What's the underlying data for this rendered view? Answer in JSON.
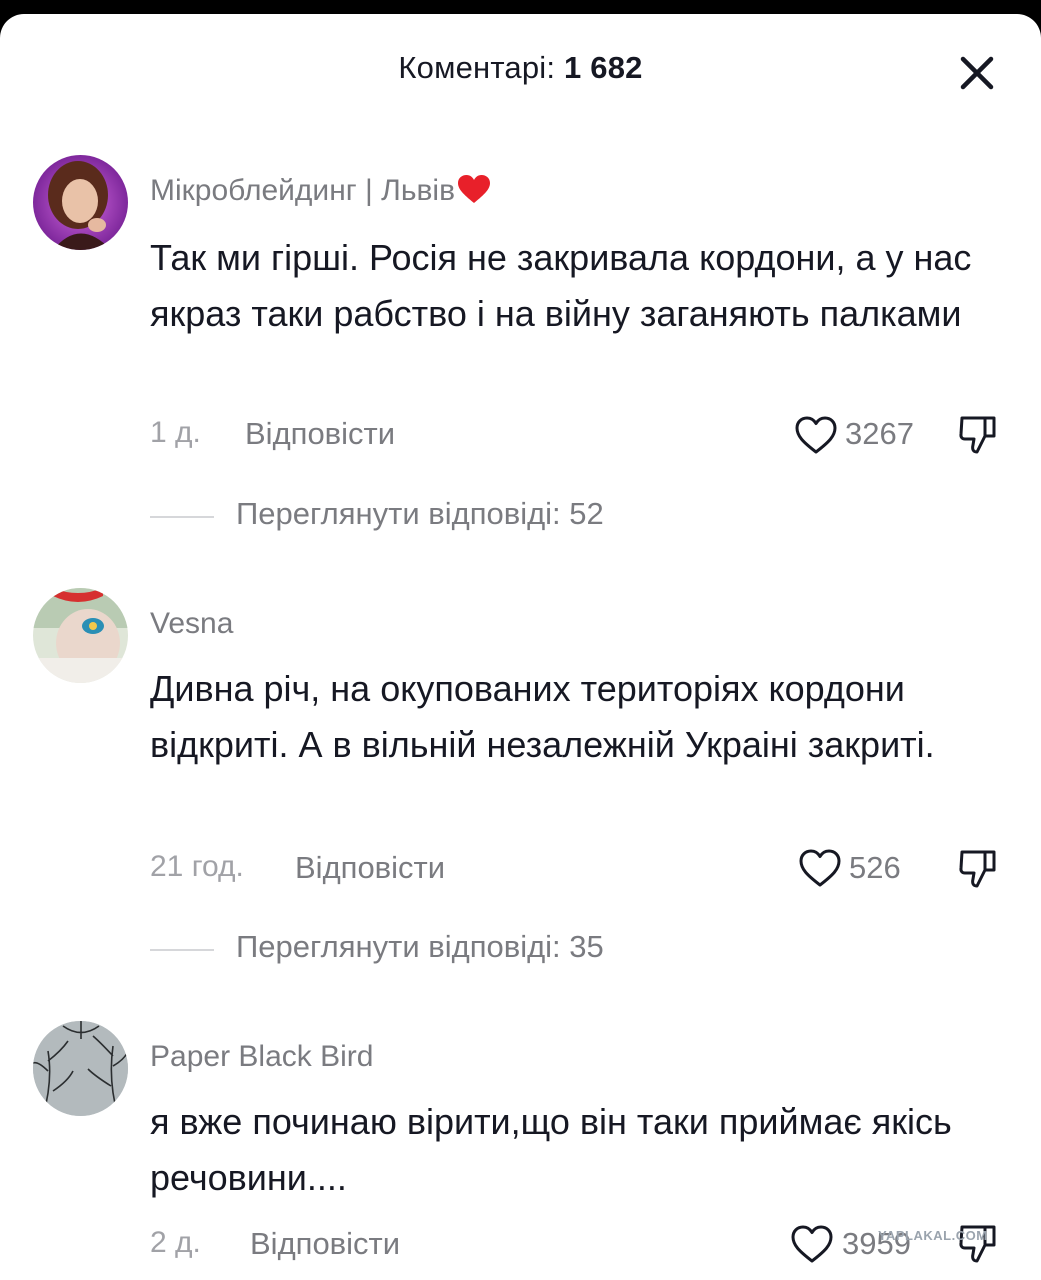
{
  "header": {
    "title_prefix": "Коментарі: ",
    "count": "1 682"
  },
  "comments": [
    {
      "username": "Мікроблейдинг | Львів",
      "username_emoji": "red-heart",
      "text": "Так ми гірші. Росія не закривала кордони, а у нас якраз таки рабство і на війну заганяють палками",
      "time": "1 д.",
      "reply_label": "Відповісти",
      "likes": "3267",
      "replies_label": "Переглянути відповіді: 52"
    },
    {
      "username": "Vesna",
      "text": "Дивна річ, на окупованих територіях кордони відкриті. А в вільній незалежній Украіні закриті.",
      "time": "21 год.",
      "reply_label": "Відповісти",
      "likes": "526",
      "replies_label": "Переглянути відповіді: 35"
    },
    {
      "username": "Paper Black Bird",
      "text": "я вже починаю вірити,що він таки приймає якісь речовини....",
      "time": "2 д.",
      "reply_label": "Відповісти",
      "likes": "3959"
    }
  ],
  "icons": {
    "close": "close-icon",
    "like": "heart-outline-icon",
    "dislike": "thumbs-down-icon"
  },
  "colors": {
    "text_primary": "#161823",
    "text_secondary": "#7a7b80",
    "emoji_heart": "#e8202a"
  },
  "watermark": "YAPLAKAL.COM"
}
